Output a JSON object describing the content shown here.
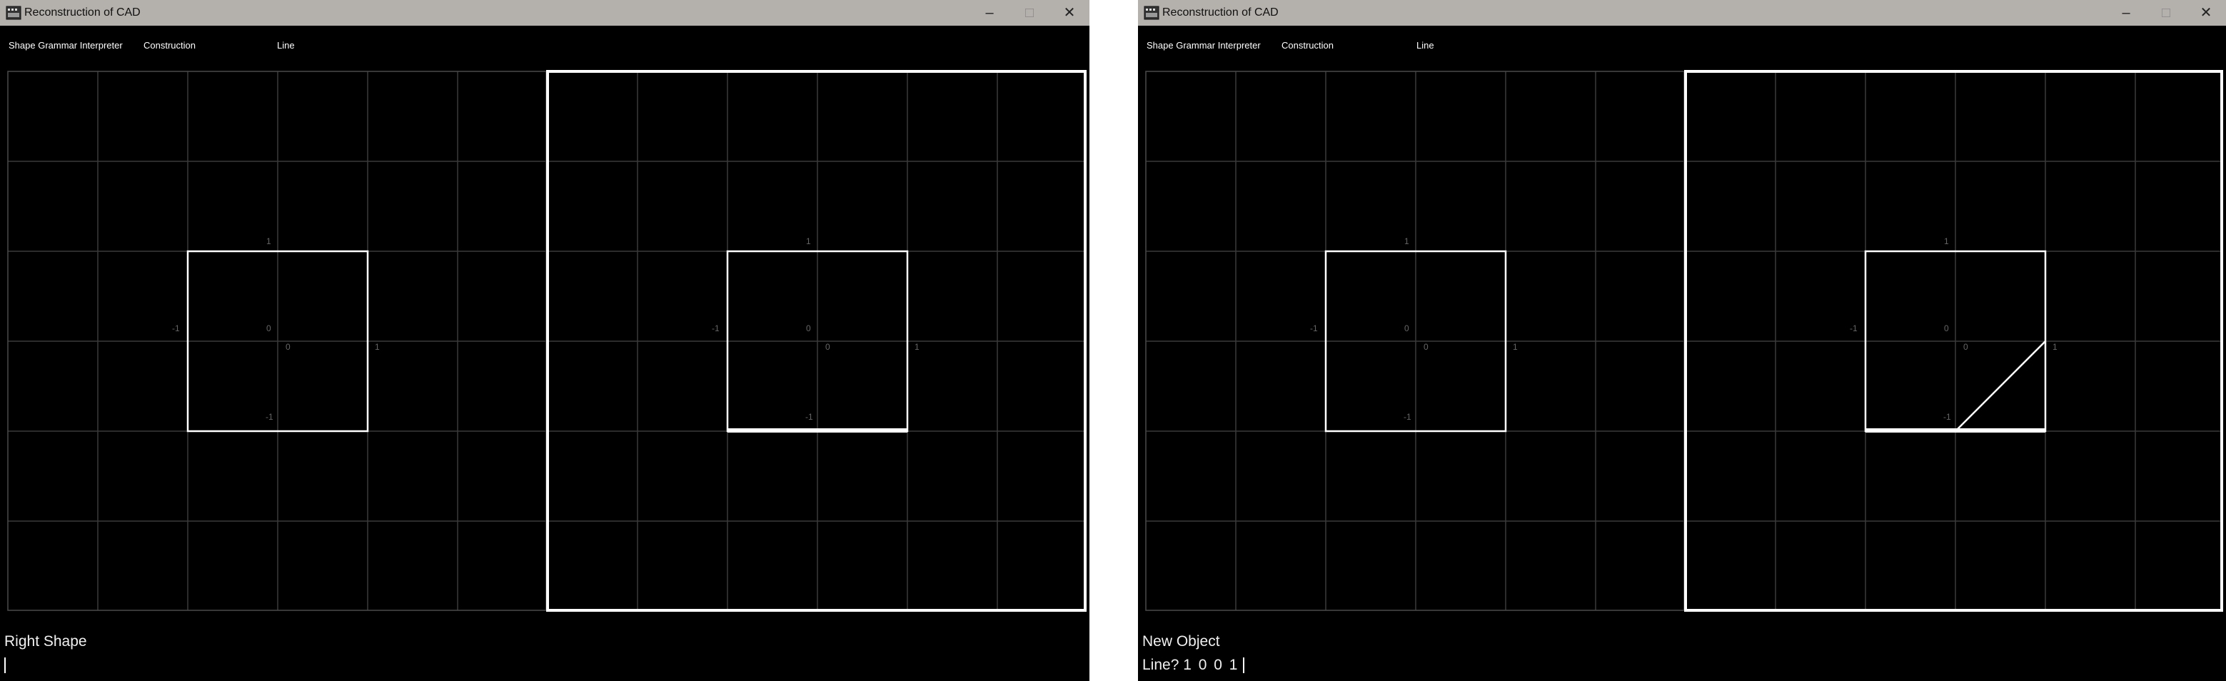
{
  "windows": [
    {
      "title": "Reconstruction of CAD",
      "controls": {
        "minimize": "–",
        "maximize": "□",
        "close": "✕"
      },
      "menu": [
        "Shape Grammar Interpreter",
        "Construction",
        "Line"
      ],
      "axis_labels": [
        "1",
        "-1",
        "0",
        "0",
        "1",
        "-1"
      ],
      "status": {
        "line1": "Right Shape",
        "prompt": "",
        "input": ""
      },
      "shape": {
        "square_min": -1,
        "square_max": 1,
        "highlight_bottom_edge": true,
        "segments": []
      }
    },
    {
      "title": "Reconstruction of CAD",
      "controls": {
        "minimize": "–",
        "maximize": "□",
        "close": "✕"
      },
      "menu": [
        "Shape Grammar Interpreter",
        "Construction",
        "Line"
      ],
      "axis_labels": [
        "1",
        "-1",
        "0",
        "0",
        "1",
        "-1"
      ],
      "status": {
        "line1": "New Object",
        "prompt": "Line?",
        "input": "1 0 0 1"
      },
      "shape": {
        "square_min": -1,
        "square_max": 1,
        "highlight_bottom_edge": true,
        "segments": [
          {
            "x1": 0,
            "y1": -1,
            "x2": 1,
            "y2": 0
          }
        ]
      }
    }
  ],
  "colors": {
    "background": "#000000",
    "grid": "#3a3a3a",
    "shape": "#ffffff",
    "titlebar": "#b4b0ab"
  }
}
